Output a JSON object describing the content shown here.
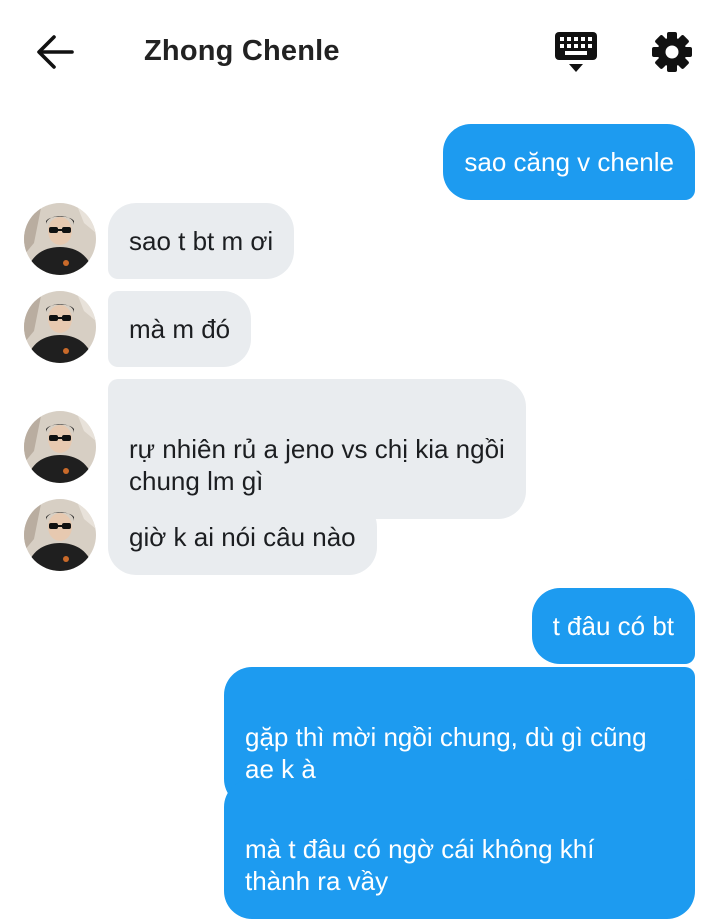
{
  "header": {
    "title": "Zhong Chenle",
    "back_icon": "arrow-left-icon",
    "keyboard_icon": "keyboard-icon",
    "settings_icon": "gear-icon"
  },
  "messages": [
    {
      "sender": "me",
      "text": "sao căng v chenle"
    },
    {
      "sender": "other",
      "text": "sao t bt m ơi"
    },
    {
      "sender": "other",
      "text": "mà m đó"
    },
    {
      "sender": "other",
      "text": "rự nhiên rủ a jeno vs chị kia ngồi\nchung lm gì"
    },
    {
      "sender": "other",
      "text": "giờ k ai nói câu nào"
    },
    {
      "sender": "me",
      "text": "t đâu có bt"
    },
    {
      "sender": "me",
      "text": "gặp thì mời ngồi chung, dù gì cũng\nae k à"
    },
    {
      "sender": "me",
      "text": "mà t đâu có ngờ cái không khí\nthành ra vầy"
    }
  ],
  "colors": {
    "outgoing_bubble": "#1d9bf0",
    "incoming_bubble": "#e9ecef",
    "background": "#ffffff"
  }
}
